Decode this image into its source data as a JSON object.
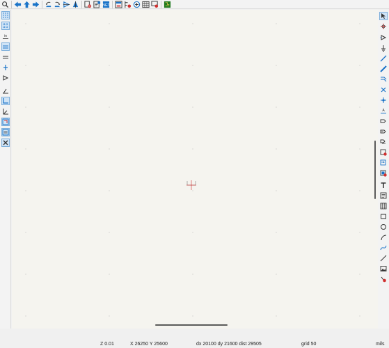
{
  "status": {
    "zoom": "Z 0.01",
    "coords": "X 26250  Y 25600",
    "delta": "dx 20100  dy 21600  dist 29505",
    "grid": "grid 50",
    "units": "mils"
  },
  "colors": {
    "canvas_bg": "#f5f4ef",
    "toolbar_bg": "#f3f3f3",
    "active_tool_bg": "#cfe3f6",
    "accent_blue": "#1a73c8",
    "cursor_red": "#d03030"
  },
  "top_toolbar_icons": [
    "zoom-icon",
    "back-arrow-icon",
    "up-arrow-icon",
    "forward-arrow-icon",
    "rotate-ccw-icon",
    "rotate-cw-icon",
    "mirror-h-icon",
    "mirror-v-icon",
    "annotate-icon",
    "erc-icon",
    "netlist-icon",
    "bom-icon",
    "symbol-editor-icon",
    "footprint-assign-icon",
    "table-icon",
    "simulator-icon",
    "pcb-editor-icon"
  ],
  "left_toolbar_icons": [
    "grid-dots-icon",
    "grid-lines-icon",
    "units-inch-icon",
    "units-mm-icon",
    "cursor-icon",
    "pin-icon",
    "hidden-pins-icon",
    "line-mode-free-icon",
    "line-mode-90-icon",
    "line-mode-45-icon",
    "hierarchy-icon",
    "properties-icon",
    "tools-icon"
  ],
  "right_toolbar_icons": [
    "select-icon",
    "highlight-net-icon",
    "add-symbol-icon",
    "add-power-icon",
    "add-wire-icon",
    "add-bus-icon",
    "bus-entry-icon",
    "no-connect-icon",
    "junction-icon",
    "net-label-icon",
    "global-label-icon",
    "hier-label-icon",
    "sheet-icon",
    "sheet-pin-icon",
    "import-sheet-pin-icon",
    "sheet-import-icon",
    "text-icon",
    "textbox-icon",
    "table-icon",
    "rectangle-icon",
    "circle-icon",
    "arc-icon",
    "bezier-icon",
    "line-icon",
    "image-icon",
    "delete-icon"
  ]
}
